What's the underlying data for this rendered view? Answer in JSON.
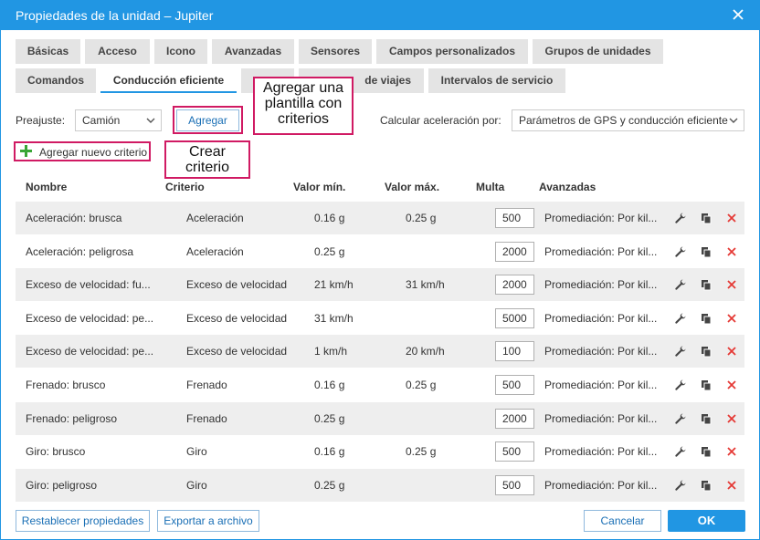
{
  "window": {
    "title": "Propiedades de la unidad – Jupiter"
  },
  "tabs_row1": [
    "Básicas",
    "Acceso",
    "Icono",
    "Avanzadas",
    "Sensores",
    "Campos personalizados",
    "Grupos de unidades"
  ],
  "tabs_row2": [
    "Comandos",
    "Conducción eficiente",
    "",
    "de viajes",
    "Intervalos de servicio"
  ],
  "active_tab": "Conducción eficiente",
  "preset": {
    "label": "Preajuste:",
    "value": "Camión",
    "add_button": "Agregar"
  },
  "accel": {
    "label": "Calcular aceleración por:",
    "value": "Parámetros de GPS y conducción eficiente"
  },
  "add_criterion": "Agregar nuevo criterio",
  "callouts": {
    "template": "Agregar una\nplantilla con\ncriterios",
    "criterion": "Crear\ncriterio"
  },
  "table": {
    "headers": {
      "name": "Nombre",
      "criterion": "Criterio",
      "min": "Valor mín.",
      "max": "Valor máx.",
      "penalty": "Multa",
      "advanced": "Avanzadas"
    },
    "rows": [
      {
        "name": "Aceleración: brusca",
        "criterion": "Aceleración",
        "min": "0.16 g",
        "max": "0.25 g",
        "penalty": "500",
        "advanced": "Promediación: Por kil..."
      },
      {
        "name": "Aceleración: peligrosa",
        "criterion": "Aceleración",
        "min": "0.25 g",
        "max": "",
        "penalty": "2000",
        "advanced": "Promediación: Por kil..."
      },
      {
        "name": "Exceso de velocidad: fu...",
        "criterion": "Exceso de velocidad",
        "min": "21 km/h",
        "max": "31 km/h",
        "penalty": "2000",
        "advanced": "Promediación: Por kil..."
      },
      {
        "name": "Exceso de velocidad: pe...",
        "criterion": "Exceso de velocidad",
        "min": "31 km/h",
        "max": "",
        "penalty": "5000",
        "advanced": "Promediación: Por kil..."
      },
      {
        "name": "Exceso de velocidad: pe...",
        "criterion": "Exceso de velocidad",
        "min": "1 km/h",
        "max": "20 km/h",
        "penalty": "100",
        "advanced": "Promediación: Por kil..."
      },
      {
        "name": "Frenado: brusco",
        "criterion": "Frenado",
        "min": "0.16 g",
        "max": "0.25 g",
        "penalty": "500",
        "advanced": "Promediación: Por kil..."
      },
      {
        "name": "Frenado: peligroso",
        "criterion": "Frenado",
        "min": "0.25 g",
        "max": "",
        "penalty": "2000",
        "advanced": "Promediación: Por kil..."
      },
      {
        "name": "Giro: brusco",
        "criterion": "Giro",
        "min": "0.16 g",
        "max": "0.25 g",
        "penalty": "500",
        "advanced": "Promediación: Por kil..."
      },
      {
        "name": "Giro: peligroso",
        "criterion": "Giro",
        "min": "0.25 g",
        "max": "",
        "penalty": "500",
        "advanced": "Promediación: Por kil..."
      }
    ]
  },
  "footer": {
    "reset": "Restablecer propiedades",
    "export": "Exportar a archivo",
    "cancel": "Cancelar",
    "ok": "OK"
  },
  "colors": {
    "accent": "#2196e3",
    "callout_border": "#d01a63",
    "delete": "#e53935",
    "plus": "#3aa636"
  }
}
